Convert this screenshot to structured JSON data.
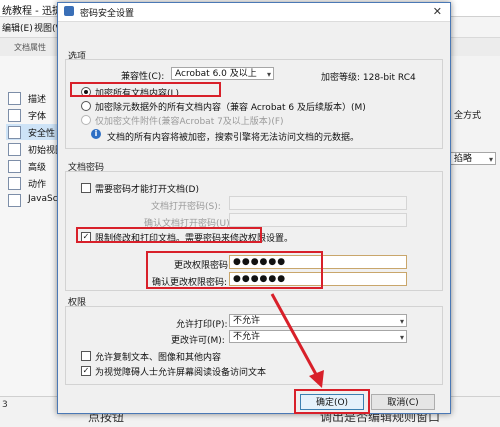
{
  "app": {
    "title": "统教程 - 迅捷PDF编辑器",
    "menu": [
      "编辑(E)",
      "视图(V)"
    ],
    "tab": "文档属性"
  },
  "sidebar": {
    "items": [
      {
        "label": "描述"
      },
      {
        "label": "字体"
      },
      {
        "label": "安全性"
      },
      {
        "label": "初始视图"
      },
      {
        "label": "高级"
      },
      {
        "label": "动作"
      },
      {
        "label": "JavaScript"
      }
    ]
  },
  "right_panel": {
    "fragment": "全方式",
    "dropdown": "掐略"
  },
  "bottom_caption": {
    "left": "3",
    "middle": "点按钮",
    "right": "调出是否编辑规则窗口"
  },
  "dialog": {
    "title": "密码安全设置",
    "options": {
      "group_title": "选项",
      "compat_label": "兼容性(C):",
      "compat_value": "Acrobat 6.0 及以上",
      "encrypt_level": "加密等级: 128-bit RC4",
      "radio1": "加密所有文档内容(L)",
      "radio2": "加密除元数据外的所有文档内容（兼容 Acrobat 6 及后续版本）(M)",
      "radio3": "仅加密文件附件(兼容Acrobat 7及以上版本)(F)",
      "info_text": "文档的所有内容将被加密，搜索引擎将无法访问文档的元数据。"
    },
    "doc_password": {
      "group_title": "文档密码",
      "require_label": "需要密码才能打开文档(D)",
      "open_pw_label": "文档打开密码(S):",
      "confirm_open_pw_label": "确认文档打开密码(U):",
      "restrict_label": "限制修改和打印文档。需要密码来修改权限设置。",
      "perm_pw_label": "更改权限密码:",
      "perm_pw_value": "●●●●●●",
      "confirm_perm_pw_label": "确认更改权限密码:",
      "confirm_perm_pw_value": "●●●●●●"
    },
    "permissions": {
      "group_title": "权限",
      "print_label": "允许打印(P):",
      "print_value": "不允许",
      "change_label": "更改许可(M):",
      "change_value": "不允许",
      "copy_label": "允许复制文本、图像和其他内容",
      "screenreader_label": "为视觉障碍人士允许屏幕阅读设备访问文本"
    },
    "buttons": {
      "ok": "确定(O)",
      "cancel": "取消(C)"
    }
  },
  "accent_colors": {
    "highlight_red": "#d8202a",
    "dialog_border": "#4a78b5"
  }
}
